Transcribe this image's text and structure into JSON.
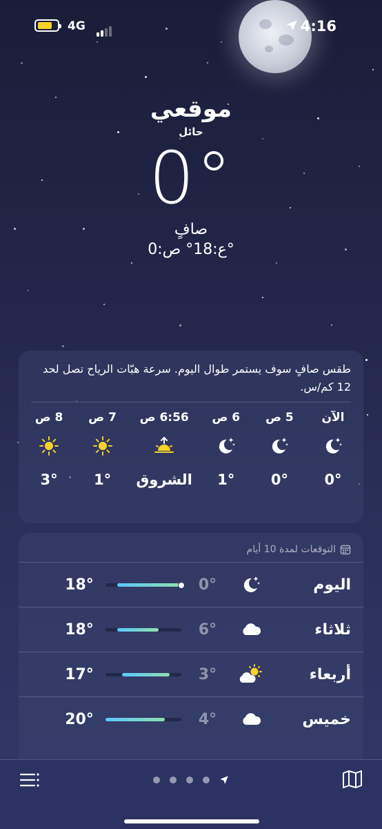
{
  "status": {
    "network": "4G",
    "time": "4:16"
  },
  "header": {
    "city": "موقعي",
    "region": "حائل",
    "temperature": "0°",
    "condition": "صافٍ",
    "hilo": "ع:18° ص:0°"
  },
  "hourly": {
    "summary": "طقس صافٍ سوف يستمر طوال اليوم. سرعة هبّات الرياح تصل لحد 12 كم/س.",
    "items": [
      {
        "label": "الآن",
        "icon": "moon-stars-icon",
        "value": "0°"
      },
      {
        "label": "5 ص",
        "icon": "moon-stars-icon",
        "value": "0°"
      },
      {
        "label": "6 ص",
        "icon": "moon-stars-icon",
        "value": "1°"
      },
      {
        "label": "6:56 ص",
        "icon": "sunrise-icon",
        "value": "الشروق"
      },
      {
        "label": "7 ص",
        "icon": "sun-icon",
        "value": "1°"
      },
      {
        "label": "8 ص",
        "icon": "sun-icon",
        "value": "3°"
      }
    ]
  },
  "forecast": {
    "title": "التوقعات لمدة 10 أيام",
    "days": [
      {
        "name": "اليوم",
        "icon": "moon-stars-icon",
        "low": "0°",
        "high": "18°",
        "range_start": 0.0,
        "range_end": 0.85,
        "current": 0.0
      },
      {
        "name": "ثلاثاء",
        "icon": "cloud-icon",
        "low": "6°",
        "high": "18°",
        "range_start": 0.3,
        "range_end": 0.85
      },
      {
        "name": "أربعاء",
        "icon": "partly-cloudy-icon",
        "low": "3°",
        "high": "17°",
        "range_start": 0.15,
        "range_end": 0.78
      },
      {
        "name": "خميس",
        "icon": "cloud-icon",
        "low": "4°",
        "high": "20°",
        "range_start": 0.22,
        "range_end": 1.0
      }
    ]
  },
  "colors": {
    "accent_yellow": "#f7d32a",
    "bar_green": "#8fdfb0",
    "bar_cyan": "#5ac8fa"
  }
}
